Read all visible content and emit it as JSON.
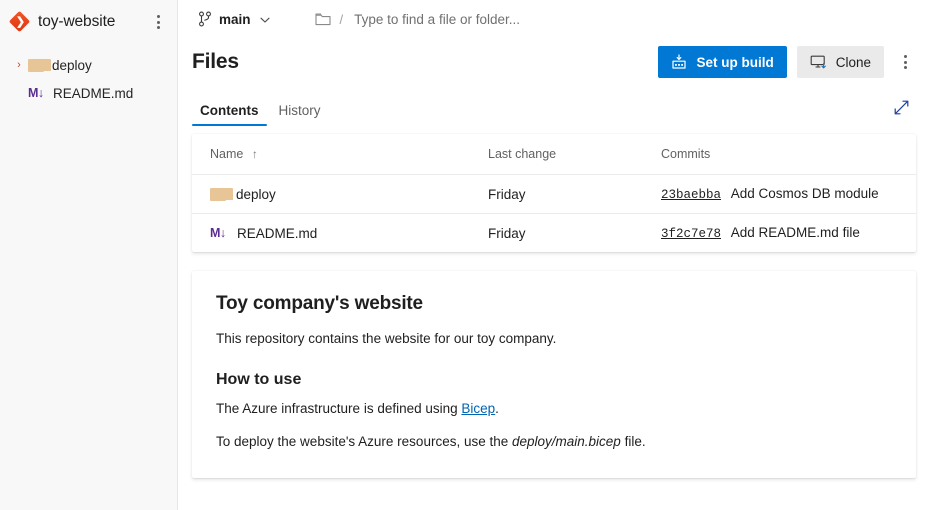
{
  "sidebar": {
    "repo_name": "toy-website",
    "repo_icon": "azure-repos-diamond-icon",
    "more_actions_label": "More actions",
    "tree": [
      {
        "label": "deploy",
        "type": "folder",
        "icon": "folder-icon",
        "expandable": true,
        "chevron": "›"
      },
      {
        "label": "README.md",
        "type": "file",
        "icon": "markdown-icon",
        "icon_text": "M↓",
        "expandable": false
      }
    ]
  },
  "topbar": {
    "branch_icon": "branch-icon",
    "branch_name": "main",
    "branch_chevron": "chevron-down-icon",
    "path_folder_icon": "folder-outline-icon",
    "path_separator": "/",
    "search_placeholder": "Type to find a file or folder...",
    "search_value": ""
  },
  "header": {
    "title": "Files",
    "setup_build_label": "Set up build",
    "setup_build_icon": "build-factory-icon",
    "clone_label": "Clone",
    "clone_icon": "clone-monitor-icon",
    "more_actions_label": "More actions"
  },
  "tabs": {
    "items": [
      {
        "label": "Contents",
        "active": true
      },
      {
        "label": "History",
        "active": false
      }
    ],
    "expand_label": "Expand",
    "expand_icon": "expand-diagonal-icon"
  },
  "files_table": {
    "columns": [
      "Name",
      "Last change",
      "Commits"
    ],
    "sort_column": "Name",
    "sort_arrow": "↑",
    "rows": [
      {
        "name": "deploy",
        "type": "folder",
        "icon": "folder-icon",
        "last_change": "Friday",
        "commit_hash": "23baebba",
        "commit_message": "Add Cosmos DB module"
      },
      {
        "name": "README.md",
        "type": "file",
        "icon": "markdown-icon",
        "icon_text": "M↓",
        "last_change": "Friday",
        "commit_hash": "3f2c7e78",
        "commit_message": "Add README.md file"
      }
    ]
  },
  "readme": {
    "heading": "Toy company's website",
    "intro": "This repository contains the website for our toy company.",
    "subheading": "How to use",
    "line_prefix": "The Azure infrastructure is defined using ",
    "link_text": "Bicep",
    "line_suffix": ".",
    "deploy_prefix": "To deploy the website's Azure resources, use the ",
    "deploy_path": "deploy/main.bicep",
    "deploy_suffix": " file."
  },
  "colors": {
    "accent": "#0078d4",
    "repo_icon": "#e8431a",
    "folder": "#e8c596",
    "markdown": "#5c2d91",
    "link": "#0065b3",
    "sidebar_bg": "#f8f8f8"
  }
}
